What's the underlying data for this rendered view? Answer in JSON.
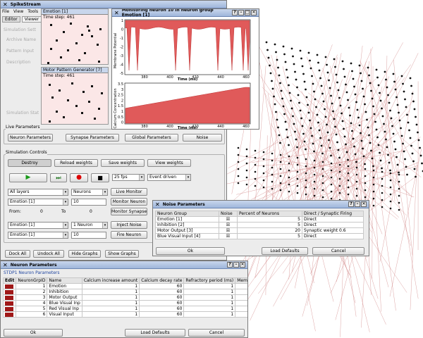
{
  "main": {
    "title": "SpikeStream",
    "menu": [
      "File",
      "View",
      "Tools"
    ],
    "tabs": [
      "Editor",
      "Viewer"
    ],
    "greyed": [
      "Simulation Sett",
      "Archive Name",
      "Pattern Input",
      "Description",
      "Simulation Stat"
    ],
    "live_params_label": "Live Parameters",
    "live_buttons": [
      "Neuron Parameters",
      "Synapse Parameters",
      "Global Parameters",
      "Noise"
    ],
    "sim_controls_label": "Simulation Controls",
    "destroy": "Destroy",
    "reload": "Reload weights",
    "save": "Save weights",
    "view": "View weights",
    "fps": "25 fps",
    "mode": "Event driven",
    "all_layers": "All layers",
    "neurons": "Neurons",
    "live_monitor": "Live Monitor",
    "emotion": "Emotion [1]",
    "neuron_field": "10",
    "monitor_neuron": "Monitor Neuron",
    "from": "From:",
    "from_val": "0",
    "to": "To",
    "to_val": "0",
    "monitor_synapse": "Monitor Synapse",
    "emotion2": "Emotion [1]",
    "one_neuron": "1 Neuron",
    "inject_noise": "Inject Noise",
    "emotion3": "Emotion [1]",
    "fire_field": "10",
    "fire_neuron": "Fire Neuron",
    "bottom_buttons": [
      "Dock All",
      "Undock All",
      "Hide Graphs",
      "Show Graphs"
    ]
  },
  "emotion_panel": {
    "title": "Emotion [1]",
    "step": "Time step: 461"
  },
  "motor_panel": {
    "title": "Motor Pattern Generator [7]",
    "step": "Time step: 461"
  },
  "monitor": {
    "title": "Monitoring neuron 10 in neuron group Emotion [1]",
    "top_ylabel": "Membrane Potential",
    "top_yticks": [
      "1",
      "0",
      "-1",
      "-2",
      "-3",
      "-4",
      "-5"
    ],
    "bottom_ylabel": "Calcium Concentration",
    "bottom_yticks": [
      "3.5",
      "3",
      "2.5",
      "2",
      "1.5",
      "1",
      "0.5",
      "0"
    ],
    "xticks": [
      "380",
      "400",
      "420",
      "440",
      "460"
    ],
    "xlabel": "Time (ms)"
  },
  "noise": {
    "title": "Noise Parameters",
    "headers": [
      "Neuron Group",
      "Noise",
      "Percent of Neurons",
      "Direct / Synaptic Firing"
    ],
    "rows": [
      [
        "Emotion [1]",
        "5",
        "Direct"
      ],
      [
        "Inhibition [2]",
        "5",
        "Direct"
      ],
      [
        "Motor Output [3]",
        "20",
        "Synaptic weight 0.6"
      ],
      [
        "Blue Visual Input [4]",
        "5",
        "Direct"
      ]
    ],
    "ok": "Ok",
    "load": "Load Defaults",
    "cancel": "Cancel"
  },
  "neuron_params": {
    "title": "Neuron Parameters",
    "subtitle": "STDP1 Neuron Parameters",
    "headers": [
      "Edit",
      "NeuronGrpID",
      "Name",
      "Calcium increase amount",
      "Calcium decay rate",
      "Refractory period (ms)",
      "Membrane"
    ],
    "rows": [
      [
        "1",
        "Emotion",
        "1",
        "60",
        "1"
      ],
      [
        "2",
        "Inhibition",
        "1",
        "60",
        "1"
      ],
      [
        "3",
        "Motor Output",
        "1",
        "60",
        "1"
      ],
      [
        "4",
        "Blue Visual Inp",
        "1",
        "60",
        "1"
      ],
      [
        "5",
        "Red Visual Inp",
        "1",
        "60",
        "1"
      ],
      [
        "6",
        "Visual Input",
        "1",
        "60",
        "1"
      ]
    ],
    "ok": "Ok",
    "load": "Load Defaults",
    "cancel": "Cancel"
  }
}
